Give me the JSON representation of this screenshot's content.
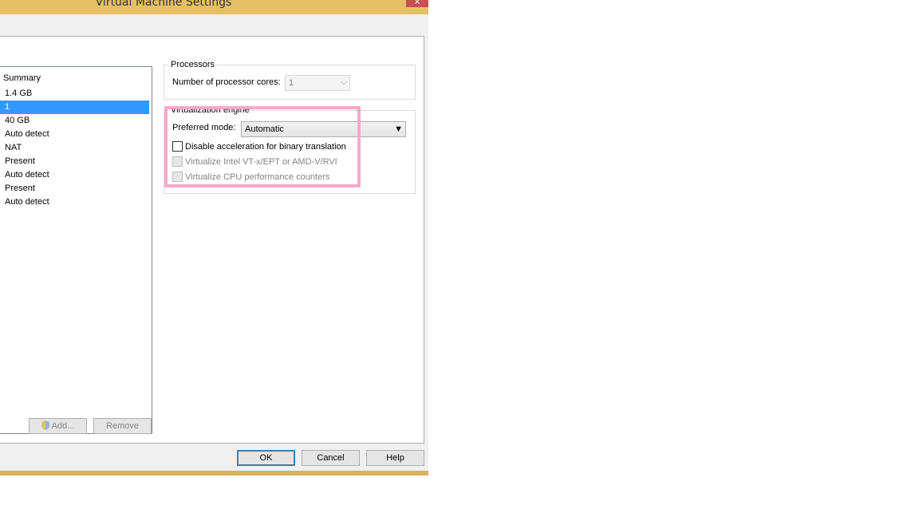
{
  "window": {
    "title": "Virtual Machine Settings",
    "close_glyph": "×"
  },
  "device_list": {
    "header": "Summary",
    "rows": [
      {
        "summary": "1.4 GB",
        "selected": false
      },
      {
        "summary": "1",
        "selected": true
      },
      {
        "summary": "40 GB",
        "selected": false
      },
      {
        "summary": "Auto detect",
        "selected": false
      },
      {
        "summary": "NAT",
        "selected": false
      },
      {
        "summary": "Present",
        "selected": false
      },
      {
        "summary": "Auto detect",
        "selected": false
      },
      {
        "summary": "Present",
        "selected": false
      },
      {
        "summary": "Auto detect",
        "selected": false
      }
    ],
    "add_label": "Add...",
    "remove_label": "Remove"
  },
  "processors": {
    "group_title": "Processors",
    "cores_label": "Number of processor cores:",
    "cores_value": "1"
  },
  "virtualization": {
    "group_title": "Virtualization engine",
    "mode_label": "Preferred mode:",
    "mode_value": "Automatic",
    "checkboxes": [
      {
        "label": "Disable acceleration for binary translation",
        "checked": false,
        "enabled": true
      },
      {
        "label": "Virtualize Intel VT-x/EPT or AMD-V/RVI",
        "checked": false,
        "enabled": false
      },
      {
        "label": "Virtualize CPU performance counters",
        "checked": false,
        "enabled": false
      }
    ]
  },
  "footer": {
    "ok_label": "OK",
    "cancel_label": "Cancel",
    "help_label": "Help"
  },
  "colors": {
    "highlight": "#f7a8c8",
    "selection": "#3399ff",
    "titlebar": "#e6bf66"
  }
}
